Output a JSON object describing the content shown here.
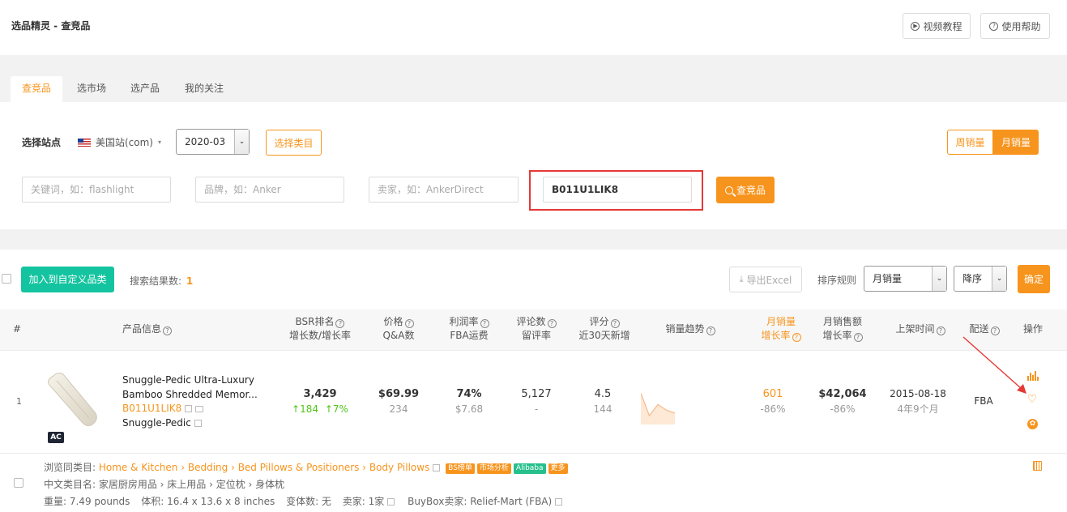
{
  "header": {
    "title": "选品精灵 - 查竞品",
    "video_tutorial": "视频教程",
    "help": "使用帮助"
  },
  "tabs": [
    {
      "label": "查竞品",
      "active": true
    },
    {
      "label": "选市场",
      "active": false
    },
    {
      "label": "选产品",
      "active": false
    },
    {
      "label": "我的关注",
      "active": false
    }
  ],
  "filters": {
    "site_label": "选择站点",
    "site_value": "美国站(com)",
    "month_value": "2020-03",
    "category_button": "选择类目",
    "weekly_sales": "周销量",
    "monthly_sales": "月销量",
    "keyword_placeholder": "关键词，如：flashlight",
    "brand_placeholder": "品牌，如：Anker",
    "seller_placeholder": "卖家，如：AnkerDirect",
    "asin_value": "B011U1LIK8",
    "search_button": "查竞品"
  },
  "toolbar": {
    "add_custom": "加入到自定义品类",
    "result_label": "搜索结果数:",
    "result_count": "1",
    "export": "导出Excel",
    "sort_label": "排序规则",
    "sort_field": "月销量",
    "sort_order": "降序",
    "confirm": "确定"
  },
  "columns": {
    "index": "#",
    "product": "产品信息",
    "bsr_1": "BSR排名",
    "bsr_2": "增长数/增长率",
    "price_1": "价格",
    "price_2": "Q&A数",
    "profit_1": "利润率",
    "profit_2": "FBA运费",
    "reviews_1": "评论数",
    "reviews_2": "留评率",
    "rating_1": "评分",
    "rating_2": "近30天新增",
    "trend": "销量趋势",
    "monthly_1": "月销量",
    "monthly_2": "增长率",
    "revenue_1": "月销售额",
    "revenue_2": "增长率",
    "listed": "上架时间",
    "fulfillment": "配送",
    "actions": "操作"
  },
  "row": {
    "index": "1",
    "badge": "AC",
    "title_line1": "Snuggle-Pedic Ultra-Luxury",
    "title_line2": "Bamboo Shredded Memor...",
    "asin": "B011U1LIK8",
    "brand": "Snuggle-Pedic",
    "bsr": "3,429",
    "bsr_growth": "↑184",
    "bsr_rate": "↑7%",
    "price": "$69.99",
    "qa": "234",
    "profit": "74%",
    "fba": "$7.68",
    "reviews": "5,127",
    "review_rate": "-",
    "rating": "4.5",
    "new_30d": "144",
    "monthly_sales": "601",
    "monthly_rate": "-86%",
    "revenue": "$42,064",
    "revenue_rate": "-86%",
    "listed_date": "2015-08-18",
    "listed_age": "4年9个月",
    "fulfillment": "FBA",
    "trend_values": [
      0.75,
      0.15,
      0.45,
      0.3,
      0.22
    ]
  },
  "details": {
    "browse_label": "浏览同类目:",
    "breadcrumb": [
      "Home & Kitchen",
      "Bedding",
      "Bed Pillows & Positioners",
      "Body Pillows"
    ],
    "tags": [
      {
        "label": "BS榜单",
        "color": "#f7941d"
      },
      {
        "label": "市场分析",
        "color": "#f7941d"
      },
      {
        "label": "Alibaba",
        "color": "#25c08b"
      },
      {
        "label": "更多",
        "color": "#f7941d"
      }
    ],
    "cn_category": "中文类目名: 家居厨房用品 › 床上用品 › 定位枕 › 身体枕",
    "weight": "重量: 7.49 pounds",
    "volume": "体积: 16.4 x 13.6 x 8 inches",
    "variants": "变体数: 无",
    "sellers": "卖家: 1家",
    "buybox": "BuyBox卖家: Relief-Mart (FBA)"
  },
  "colors": {
    "accent": "#f7941d",
    "green": "#14c4a0",
    "red": "#e53935"
  }
}
